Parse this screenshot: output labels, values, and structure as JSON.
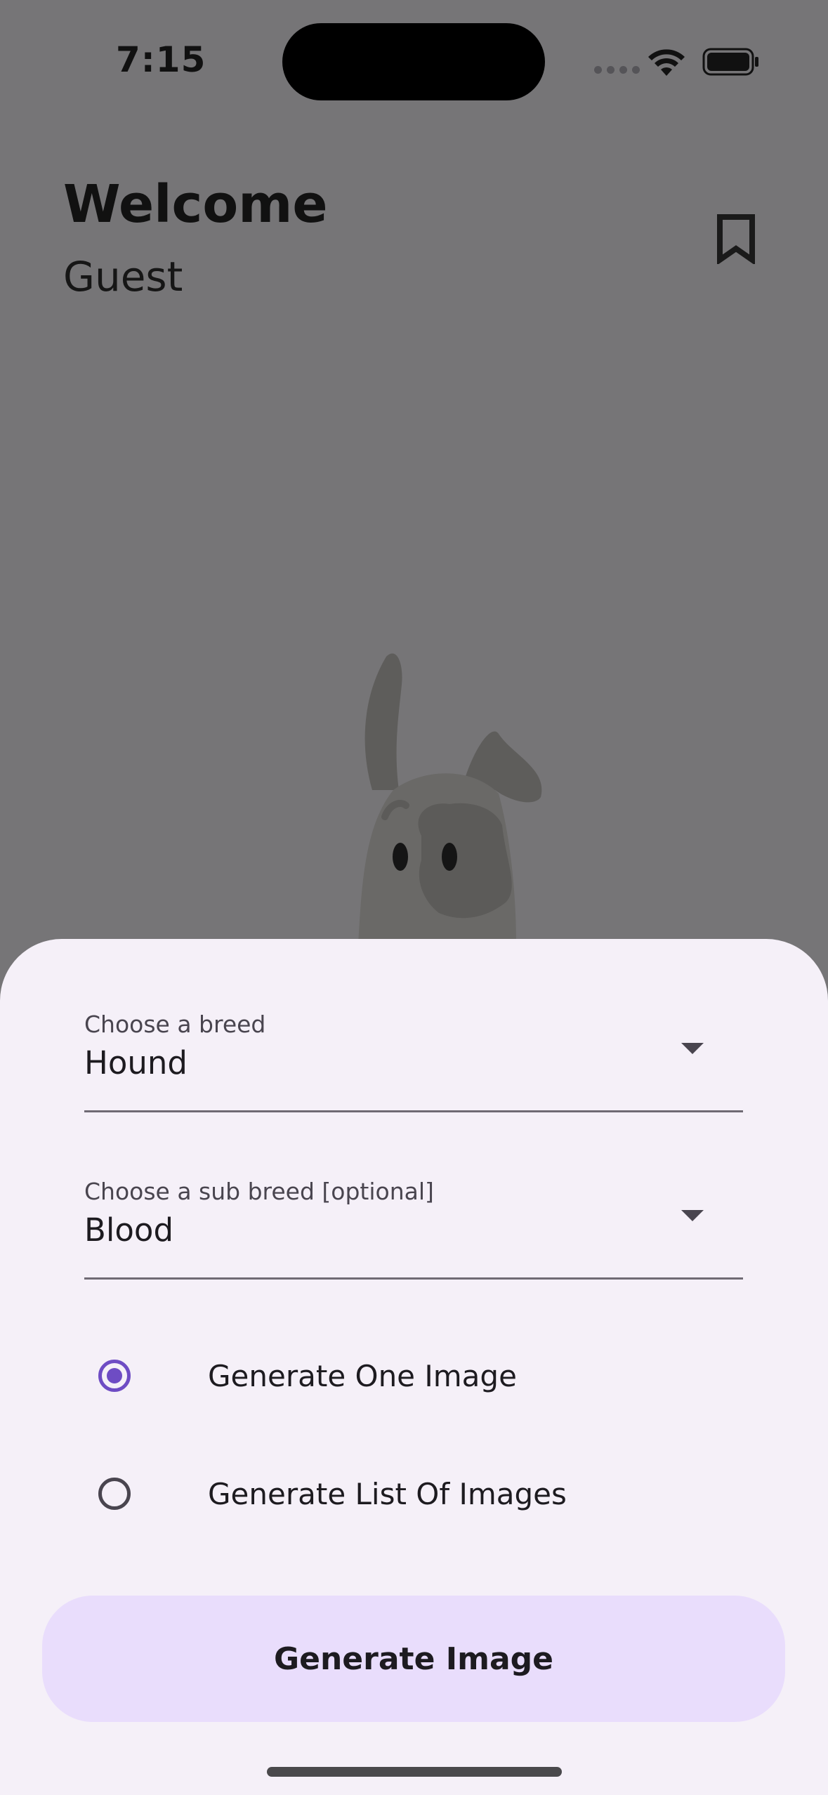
{
  "status_bar": {
    "time": "7:15"
  },
  "header": {
    "title": "Welcome",
    "subtitle": "Guest",
    "bookmark_icon": "bookmark-icon"
  },
  "form": {
    "breed": {
      "label": "Choose a breed",
      "value": "Hound"
    },
    "sub_breed": {
      "label": "Choose a sub breed [optional]",
      "value": "Blood"
    },
    "options": [
      {
        "label": "Generate One Image",
        "selected": true
      },
      {
        "label": "Generate List Of Images",
        "selected": false
      }
    ],
    "submit_label": "Generate Image"
  },
  "colors": {
    "accent": "#6e4cc4",
    "button_bg": "#e9ddfc",
    "sheet_bg": "#f5f0f8",
    "scrim": "#767577"
  }
}
